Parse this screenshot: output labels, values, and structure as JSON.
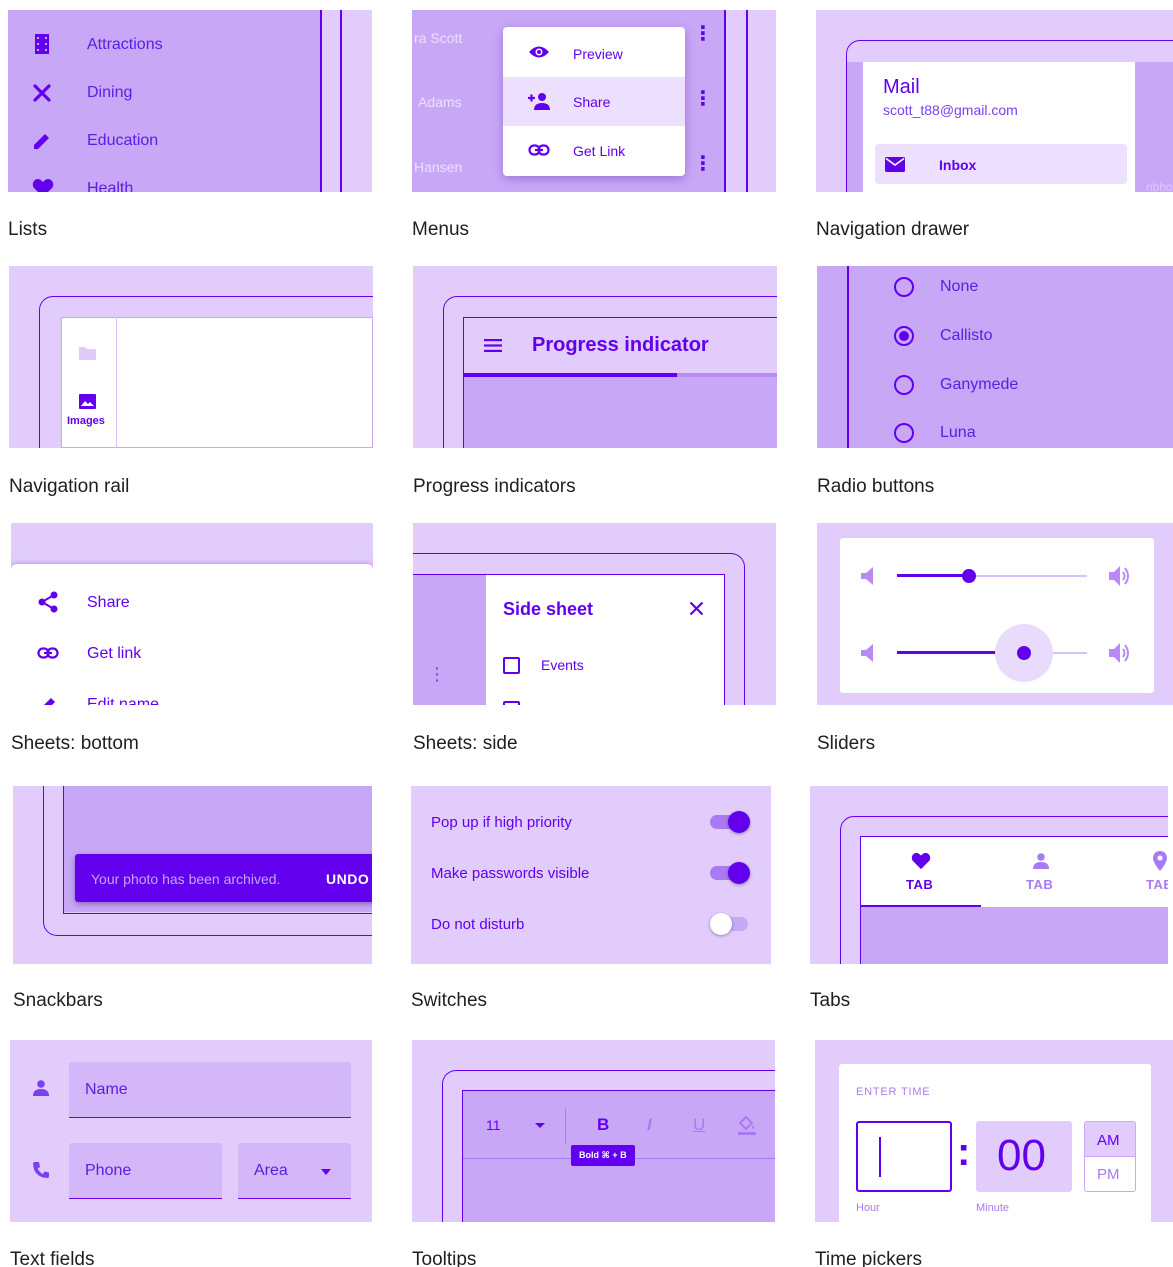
{
  "colors": {
    "primary": "#6200ee",
    "light": "#e1ccfb",
    "medium": "#c9a7f7"
  },
  "cards": {
    "lists": {
      "caption": "Lists",
      "items": [
        {
          "icon": "film-icon",
          "label": "Attractions"
        },
        {
          "icon": "restaurant-icon",
          "label": "Dining"
        },
        {
          "icon": "pencil-icon",
          "label": "Education"
        },
        {
          "icon": "heart-icon",
          "label": "Health"
        }
      ]
    },
    "menus": {
      "caption": "Menus",
      "bg_names": [
        "ra Scott",
        "Adams",
        "Hansen"
      ],
      "items": [
        {
          "icon": "eye-icon",
          "label": "Preview"
        },
        {
          "icon": "person-add-icon",
          "label": "Share"
        },
        {
          "icon": "link-icon",
          "label": "Get Link"
        }
      ]
    },
    "navigation_drawer": {
      "caption": "Navigation drawer",
      "title": "Mail",
      "email": "scott_t88@gmail.com",
      "item": {
        "icon": "mail-icon",
        "label": "Inbox"
      },
      "peek_text": "nbhor"
    },
    "navigation_rail": {
      "caption": "Navigation rail",
      "item_label": "Images"
    },
    "progress_indicators": {
      "caption": "Progress indicators",
      "title": "Progress indicator",
      "progress": 0.68
    },
    "radio_buttons": {
      "caption": "Radio buttons",
      "options": [
        "None",
        "Callisto",
        "Ganymede",
        "Luna"
      ],
      "selected": "Callisto"
    },
    "sheets_bottom": {
      "caption": "Sheets: bottom",
      "items": [
        {
          "icon": "share-icon",
          "label": "Share"
        },
        {
          "icon": "link-icon",
          "label": "Get link"
        },
        {
          "icon": "pencil-icon",
          "label": "Edit name"
        }
      ]
    },
    "sheets_side": {
      "caption": "Sheets: side",
      "title": "Side sheet",
      "item": "Events"
    },
    "sliders": {
      "caption": "Sliders",
      "values": [
        0.38,
        0.67
      ]
    },
    "snackbars": {
      "caption": "Snackbars",
      "message": "Your photo has been archived.",
      "action": "UNDO"
    },
    "switches": {
      "caption": "Switches",
      "items": [
        {
          "label": "Pop up if high priority",
          "on": true
        },
        {
          "label": "Make passwords visible",
          "on": true
        },
        {
          "label": "Do not disturb",
          "on": false
        }
      ]
    },
    "tabs": {
      "caption": "Tabs",
      "items": [
        {
          "icon": "heart-icon",
          "label": "TAB"
        },
        {
          "icon": "person-icon",
          "label": "TAB"
        },
        {
          "icon": "location-icon",
          "label": "TAB"
        }
      ],
      "selected": 0
    },
    "text_fields": {
      "caption": "Text fields",
      "name_label": "Name",
      "phone_label": "Phone",
      "area_label": "Area"
    },
    "tooltips": {
      "caption": "Tooltips",
      "font_size": "11",
      "bold": "B",
      "italic": "I",
      "underline": "U",
      "tooltip": "Bold ⌘ + B"
    },
    "time_pickers": {
      "caption": "Time pickers",
      "header": "ENTER TIME",
      "hour": "",
      "separator": ":",
      "minute": "00",
      "am": "AM",
      "pm": "PM",
      "hour_label": "Hour",
      "minute_label": "Minute"
    }
  }
}
